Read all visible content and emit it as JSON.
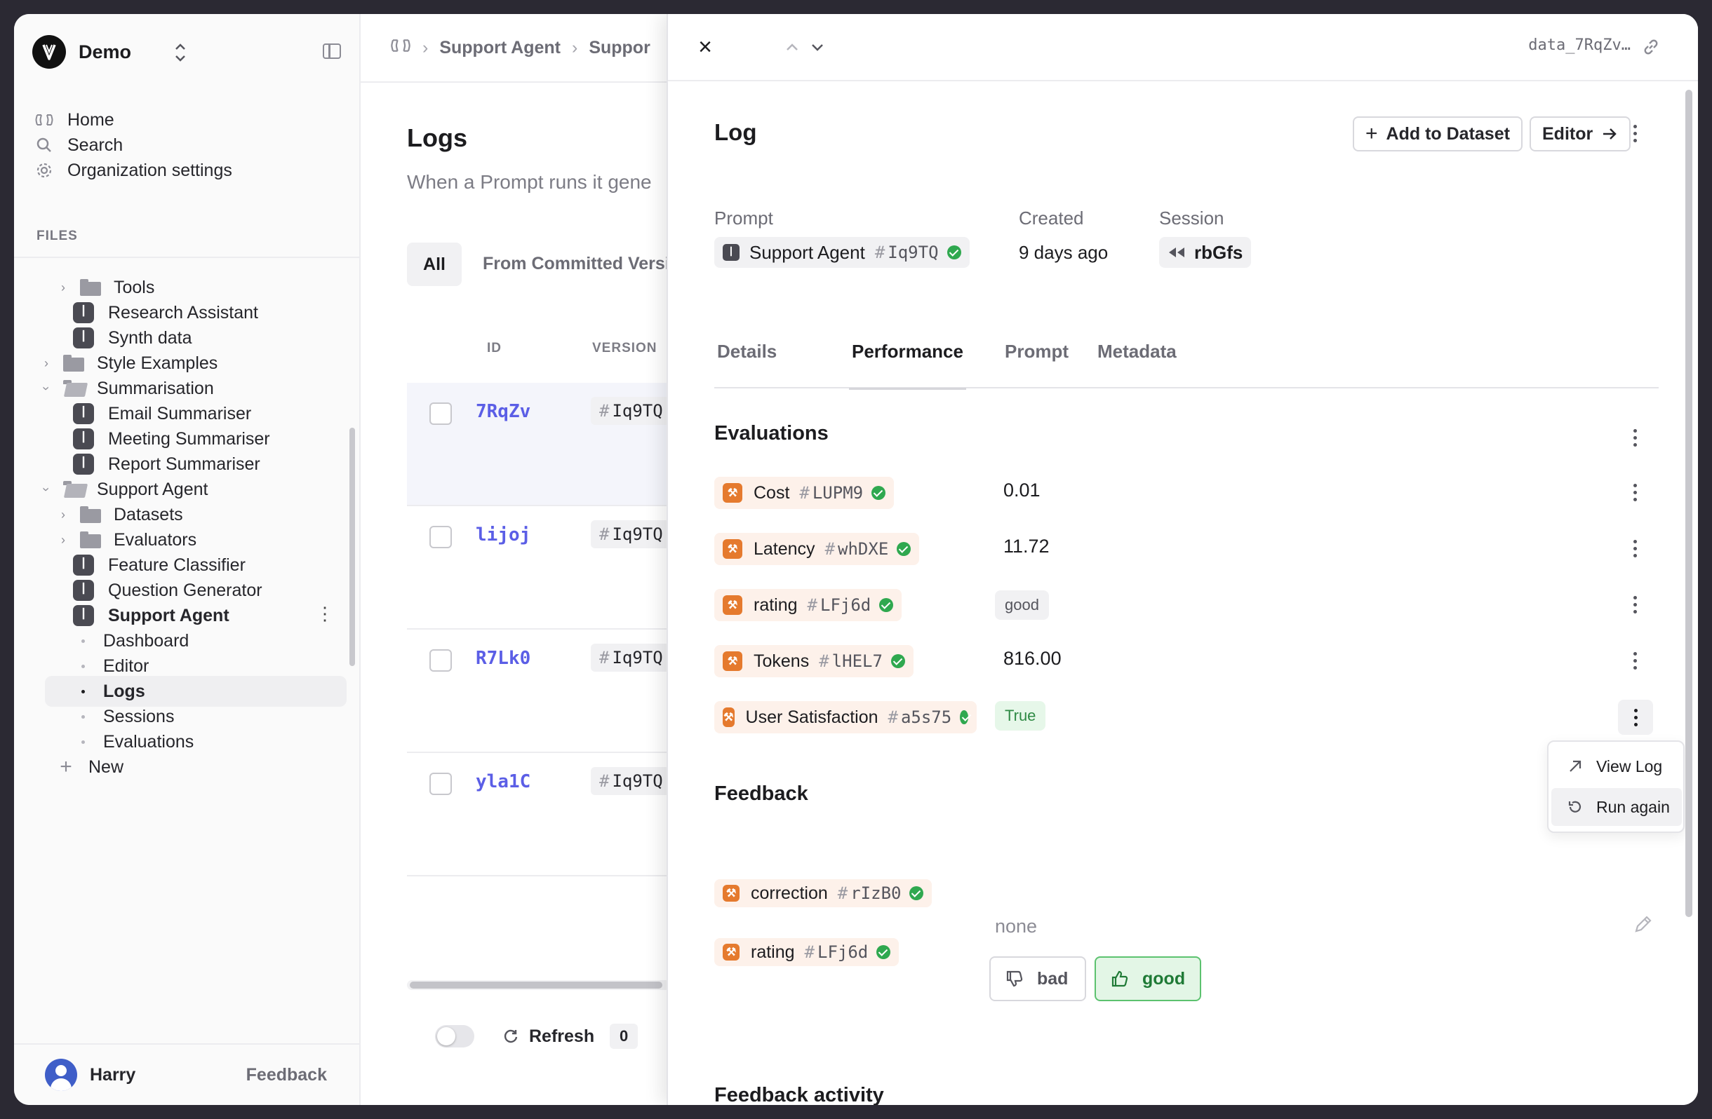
{
  "workspace": {
    "name": "Demo"
  },
  "nav": [
    {
      "label": "Home",
      "icon": "humanloop-icon"
    },
    {
      "label": "Search",
      "icon": "search-icon"
    },
    {
      "label": "Organization settings",
      "icon": "gear-icon"
    }
  ],
  "files_label": "FILES",
  "tree": [
    {
      "label": "Tools",
      "kind": "folder",
      "expanded": false
    },
    {
      "label": "Research Assistant",
      "kind": "prompt"
    },
    {
      "label": "Synth data",
      "kind": "prompt"
    },
    {
      "label": "Style Examples",
      "kind": "folder",
      "expanded": false
    },
    {
      "label": "Summarisation",
      "kind": "folder",
      "expanded": true
    },
    {
      "label": "Email Summariser",
      "kind": "prompt"
    },
    {
      "label": "Meeting Summariser",
      "kind": "prompt"
    },
    {
      "label": "Report Summariser",
      "kind": "prompt"
    },
    {
      "label": "Support Agent",
      "kind": "folder",
      "expanded": true
    },
    {
      "label": "Datasets",
      "kind": "folder",
      "expanded": false
    },
    {
      "label": "Evaluators",
      "kind": "folder",
      "expanded": false
    },
    {
      "label": "Feature Classifier",
      "kind": "prompt"
    },
    {
      "label": "Question Generator",
      "kind": "prompt"
    },
    {
      "label": "Support Agent",
      "kind": "prompt",
      "selected": true
    },
    {
      "label": "Dashboard",
      "kind": "sub"
    },
    {
      "label": "Editor",
      "kind": "sub"
    },
    {
      "label": "Logs",
      "kind": "sub",
      "active": true
    },
    {
      "label": "Sessions",
      "kind": "sub"
    },
    {
      "label": "Evaluations",
      "kind": "sub"
    }
  ],
  "new_label": "New",
  "user": {
    "name": "Harry",
    "feedback": "Feedback"
  },
  "breadcrumb": [
    "Support Agent",
    "Suppor"
  ],
  "logs_page": {
    "title": "Logs",
    "description": "When a Prompt runs it gene",
    "filters": [
      "All",
      "From Committed Versi"
    ],
    "columns": [
      "ID",
      "VERSION"
    ],
    "rows": [
      {
        "id": "7RqZv",
        "version": "Iq9TQ"
      },
      {
        "id": "lijoj",
        "version": "Iq9TQ"
      },
      {
        "id": "R7Lk0",
        "version": "Iq9TQ"
      },
      {
        "id": "yla1C",
        "version": "Iq9TQ"
      }
    ],
    "refresh_label": "Refresh",
    "refresh_count": "0"
  },
  "panel": {
    "data_id": "data_7RqZv…",
    "title": "Log",
    "add_to_dataset": "Add to Dataset",
    "editor": "Editor",
    "meta": {
      "prompt_label": "Prompt",
      "prompt_name": "Support Agent",
      "prompt_version": "Iq9TQ",
      "created_label": "Created",
      "created_value": "9 days ago",
      "session_label": "Session",
      "session_value": "rbGfs"
    },
    "tabs": [
      "Details",
      "Performance",
      "Prompt",
      "Metadata"
    ],
    "active_tab": "Performance",
    "evaluations_title": "Evaluations",
    "evaluations": [
      {
        "name": "Cost",
        "version": "LUPM9",
        "value": "0.01"
      },
      {
        "name": "Latency",
        "version": "whDXE",
        "value": "11.72"
      },
      {
        "name": "rating",
        "version": "LFj6d",
        "value": "good"
      },
      {
        "name": "Tokens",
        "version": "lHEL7",
        "value": "816.00"
      },
      {
        "name": "User Satisfaction",
        "version": "a5s75",
        "value": "True"
      }
    ],
    "menu": [
      {
        "label": "View Log",
        "icon": "arrow-up-right-icon"
      },
      {
        "label": "Run again",
        "icon": "rotate-icon"
      }
    ],
    "feedback_title": "Feedback",
    "feedback": [
      {
        "name": "correction",
        "version": "rIzB0",
        "value": "none"
      },
      {
        "name": "rating",
        "version": "LFj6d"
      }
    ],
    "feedback_buttons": {
      "bad": "bad",
      "good": "good"
    },
    "feedback_activity_title": "Feedback activity"
  },
  "colors": {
    "accent_id": "#5b5ee6",
    "evaluator_orange": "#e57a2e",
    "success_green": "#2fa84f"
  }
}
